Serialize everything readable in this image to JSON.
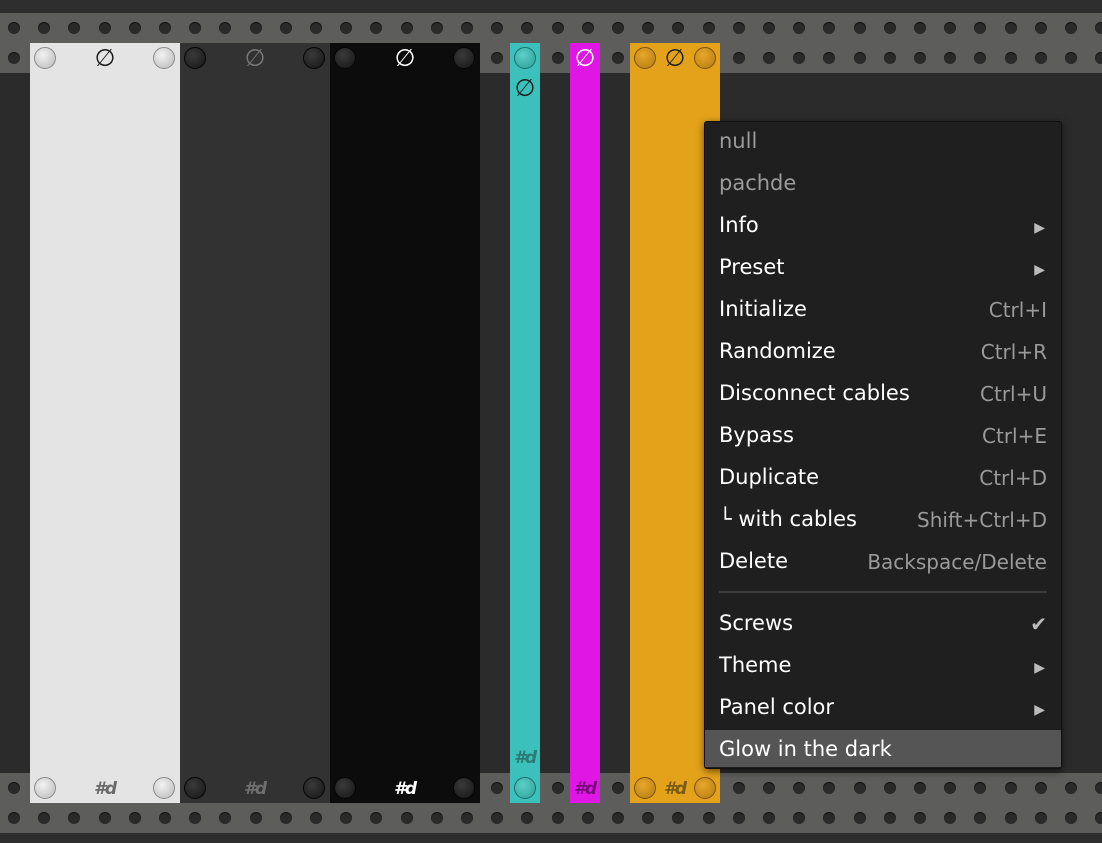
{
  "panels": [
    {
      "name": "light-panel",
      "bg": "#e4e4e4",
      "symbol": "∅",
      "logo": "#d",
      "symbol_color": "#1a1a1a",
      "logo_color": "#6a6a6a",
      "screw_style": "light"
    },
    {
      "name": "dark-panel",
      "bg": "#323232",
      "symbol": "∅",
      "logo": "#d",
      "symbol_color": "#777777",
      "logo_color": "#6f6f6f",
      "screw_style": "dark"
    },
    {
      "name": "black-panel",
      "bg": "#0c0c0c",
      "symbol": "∅",
      "logo": "#d",
      "symbol_color": "#ffffff",
      "logo_color": "#ffffff",
      "screw_style": "dark"
    },
    {
      "name": "teal-panel",
      "bg": "#3bc0bb",
      "symbol": "∅",
      "logo": "#d",
      "symbol_color": "#1f1f1f",
      "logo_color": "#2a7a76",
      "screw_style": "teal"
    },
    {
      "name": "magenta-panel",
      "bg": "#e016e4",
      "symbol": "∅",
      "logo": "#d",
      "symbol_color": "#ffffff",
      "logo_color": "#7b0a7d",
      "screw_style": "none"
    },
    {
      "name": "orange-panel",
      "bg": "#e4a21b",
      "symbol": "∅",
      "logo": "#d",
      "symbol_color": "#222222",
      "logo_color": "#7a5a10",
      "screw_style": "orange"
    }
  ],
  "menu": {
    "header": "null",
    "subheader": "pachde",
    "items": [
      {
        "label": "Info",
        "submenu": true
      },
      {
        "label": "Preset",
        "submenu": true
      },
      {
        "label": "Initialize",
        "shortcut": "Ctrl+I"
      },
      {
        "label": "Randomize",
        "shortcut": "Ctrl+R"
      },
      {
        "label": "Disconnect cables",
        "shortcut": "Ctrl+U"
      },
      {
        "label": "Bypass",
        "shortcut": "Ctrl+E"
      },
      {
        "label": "Duplicate",
        "shortcut": "Ctrl+D"
      },
      {
        "label": "└ with cables",
        "shortcut": "Shift+Ctrl+D"
      },
      {
        "label": "Delete",
        "shortcut": "Backspace/Delete"
      },
      {
        "label": "Screws",
        "check": "✔"
      },
      {
        "label": "Theme",
        "submenu": true
      },
      {
        "label": "Panel color",
        "submenu": true
      },
      {
        "label": "Glow in the dark",
        "highlighted": true
      }
    ],
    "submenu_arrow": "▶"
  },
  "colors": {
    "rail": "#595956",
    "rack_background": "#2b2b2b",
    "menu_background": "#1f1f1f",
    "menu_highlight": "#555555"
  }
}
